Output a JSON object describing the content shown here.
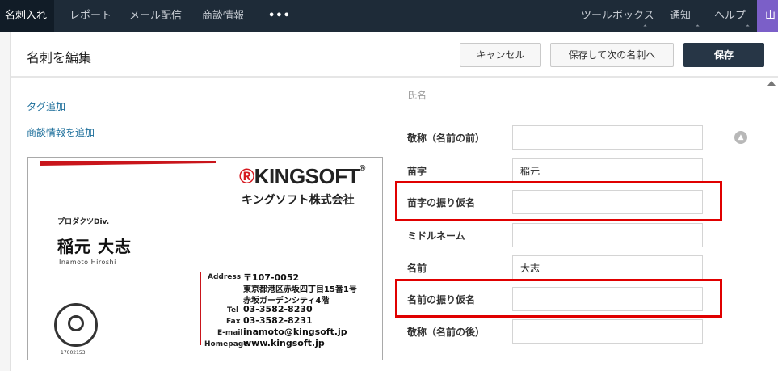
{
  "nav": {
    "active": "名刺入れ",
    "items": [
      "レポート",
      "メール配信",
      "商談情報"
    ],
    "more": "•••",
    "right_items": [
      "ツールボックス",
      "通知",
      "ヘルプ"
    ],
    "user_initial": "山"
  },
  "header": {
    "title": "名刺を編集",
    "cancel_label": "キャンセル",
    "save_next_label": "保存して次の名刺へ",
    "save_label": "保存"
  },
  "left_links": {
    "add_tag": "タグ追加",
    "add_deal": "商談情報を追加"
  },
  "card": {
    "logo_mark": "®",
    "logo_text": "KINGSOFT",
    "logo_reg": "®",
    "company_jp": "キングソフト株式会社",
    "dept": "プロダクツDiv.",
    "name": "稲元 大志",
    "name_roman": "Inamoto Hiroshi",
    "address_label": "Address",
    "address_lines": [
      "〒107-0052",
      "東京都港区赤坂四丁目15番1号",
      "赤坂ガーデンシティ4階"
    ],
    "tel_label": "Tel",
    "tel": "03-3582-8230",
    "fax_label": "Fax",
    "fax": "03-3582-8231",
    "email_label": "E-mail",
    "email": "inamoto@kingsoft.jp",
    "homepage_label": "Homepage",
    "homepage": "www.kingsoft.jp",
    "privacy_number": "17002153"
  },
  "form": {
    "section_title": "氏名",
    "fields": [
      {
        "label": "敬称（名前の前）",
        "value": ""
      },
      {
        "label": "苗字",
        "value": "稲元"
      },
      {
        "label": "苗字の振り仮名",
        "value": ""
      },
      {
        "label": "ミドルネーム",
        "value": ""
      },
      {
        "label": "名前",
        "value": "大志"
      },
      {
        "label": "名前の振り仮名",
        "value": ""
      },
      {
        "label": "敬称（名前の後）",
        "value": ""
      }
    ]
  },
  "colors": {
    "nav_bg": "#1e2b38",
    "primary_button": "#273646",
    "highlight": "#e00000",
    "brand_red": "#d6181f",
    "user_badge": "#7b5fc8"
  }
}
